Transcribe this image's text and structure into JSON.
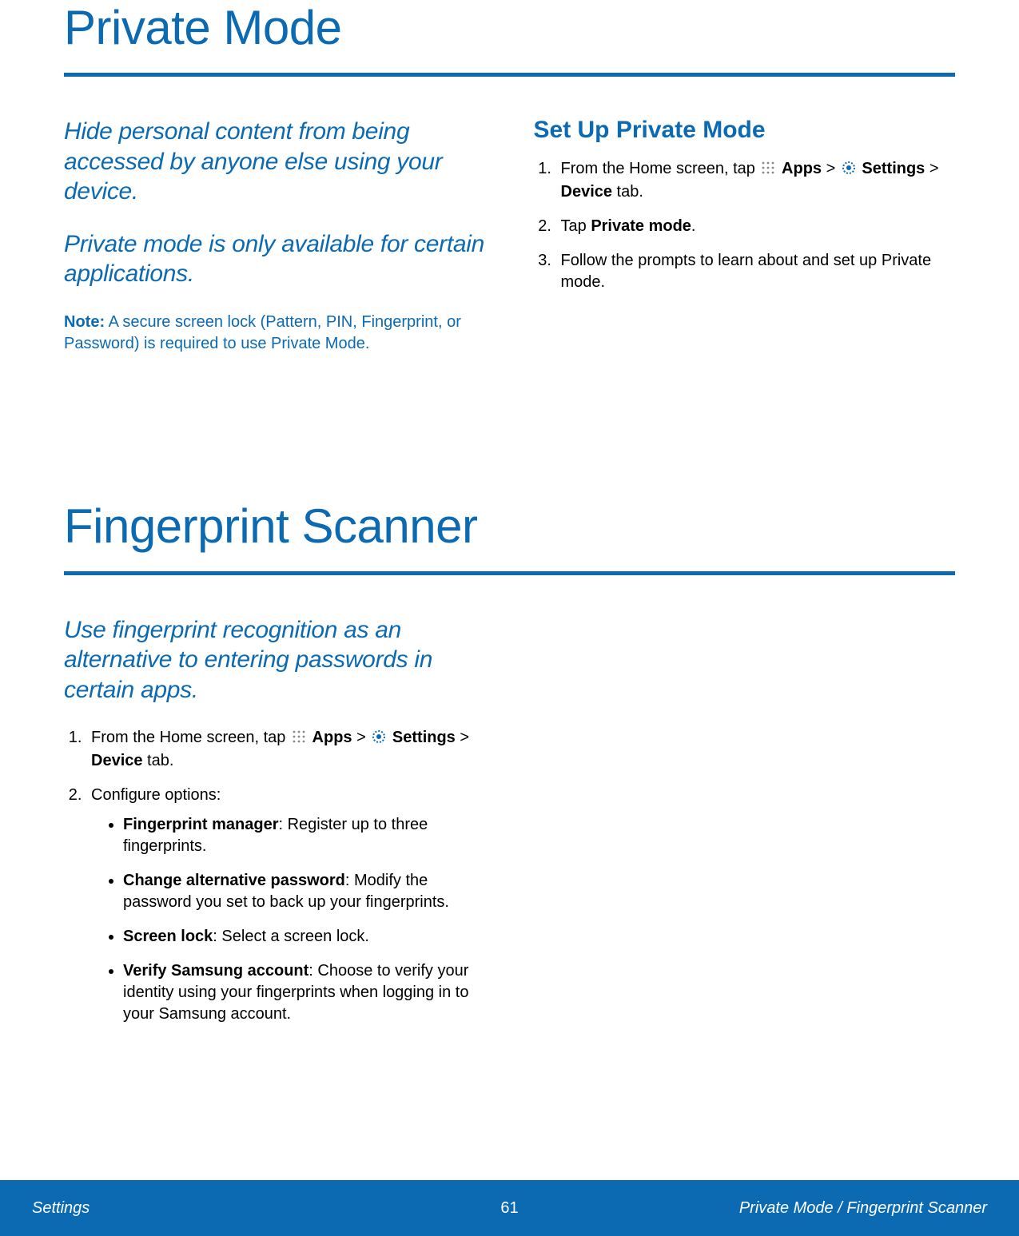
{
  "colors": {
    "accent": "#0b6ab2"
  },
  "section1": {
    "title": "Private Mode",
    "lead1": "Hide personal content from being accessed by anyone else using your device.",
    "lead2": "Private mode is only available for certain applications.",
    "note_label": "Note:",
    "note_text": " A secure screen lock (Pattern, PIN, Fingerprint, or Password) is required to use Private Mode.",
    "sub_title": "Set Up Private Mode",
    "steps": [
      {
        "prefix": "From the Home screen, tap ",
        "apps": "Apps",
        "gt1": " > ",
        "settings": "Settings",
        "gt2": " > ",
        "device": "Device",
        "suffix": " tab."
      },
      {
        "prefix": "Tap ",
        "bold": "Private mode",
        "suffix": "."
      },
      {
        "text": "Follow the prompts to learn about and set up Private mode."
      }
    ]
  },
  "section2": {
    "title": "Fingerprint Scanner",
    "lead": "Use fingerprint recognition as an alternative to entering passwords in certain apps.",
    "steps": [
      {
        "prefix": "From the Home screen, tap ",
        "apps": "Apps",
        "gt1": " > ",
        "settings": "Settings",
        "gt2": " > ",
        "device": "Device",
        "suffix": " tab."
      },
      {
        "text": "Configure options:"
      }
    ],
    "options": [
      {
        "bold": "Fingerprint manager",
        "rest": ": Register up to three fingerprints."
      },
      {
        "bold": "Change alternative password",
        "rest": ": Modify the password you set to back up your fingerprints."
      },
      {
        "bold": "Screen lock",
        "rest": ": Select a screen lock."
      },
      {
        "bold": "Verify Samsung account",
        "rest": ": Choose to verify your identity using your fingerprints when logging in to your Samsung account."
      }
    ]
  },
  "footer": {
    "left": "Settings",
    "center": "61",
    "right": "Private Mode / Fingerprint Scanner"
  }
}
